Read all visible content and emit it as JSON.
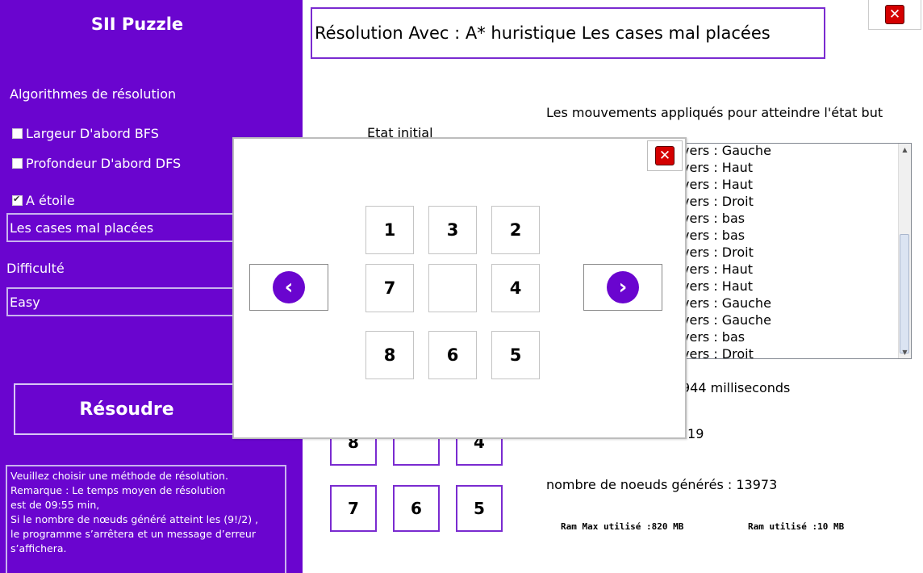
{
  "sidebar": {
    "title": "SII Puzzle",
    "section_label": "Algorithmes de résolution",
    "options": [
      {
        "label": "Largeur D'abord  BFS",
        "checked": false
      },
      {
        "label": "Profondeur  D'abord  DFS",
        "checked": false
      },
      {
        "label": "A étoile",
        "checked": true
      }
    ],
    "heuristic_value": "Les cases mal placées",
    "difficulty_label": "Difficulté",
    "difficulty_value": "Easy",
    "solve_label": "Résoudre",
    "note_lines": [
      "Veuillez choisir une méthode de résolution.",
      "Remarque : Le temps moyen de résolution",
      "est de 09:55 min,",
      "Si le nombre de nœuds généré atteint  les (9!/2) ,",
      "le programme s’arrêtera et un message d’erreur",
      "s’affichera."
    ]
  },
  "main": {
    "title": "Résolution Avec : A* huristique Les cases mal placées",
    "moves_label": "Les mouvements appliqués pour atteindre l'état but",
    "initial_label": "Etat initial",
    "moves": [
      "vers : Gauche",
      "vers : Haut",
      "vers : Haut",
      "vers : Droit",
      " vers : bas",
      " vers : bas",
      " vers : Droit",
      " vers : Haut",
      " vers : Haut",
      " vers : Gauche",
      " vers : Gauche",
      " vers : bas",
      " vers : Droit"
    ],
    "time_text": "944 milliseconds",
    "depth_text": "tion:19",
    "nodes_text": "nombre de noeuds générés : 13973",
    "ram_max_text": "Ram Max utilisé :820 MB",
    "ram_used_text": "Ram utilisé :10 MB",
    "partial_tiles": [
      "8",
      "",
      "4"
    ],
    "bottom_tiles": [
      "7",
      "6",
      "5"
    ]
  },
  "dialog": {
    "tiles": [
      "1",
      "3",
      "2",
      "7",
      "",
      "4",
      "8",
      "6",
      "5"
    ],
    "prev_icon": "chevron-left-icon",
    "next_icon": "chevron-right-icon"
  },
  "colors": {
    "accent": "#6a05cf",
    "close_red": "#d40000"
  }
}
